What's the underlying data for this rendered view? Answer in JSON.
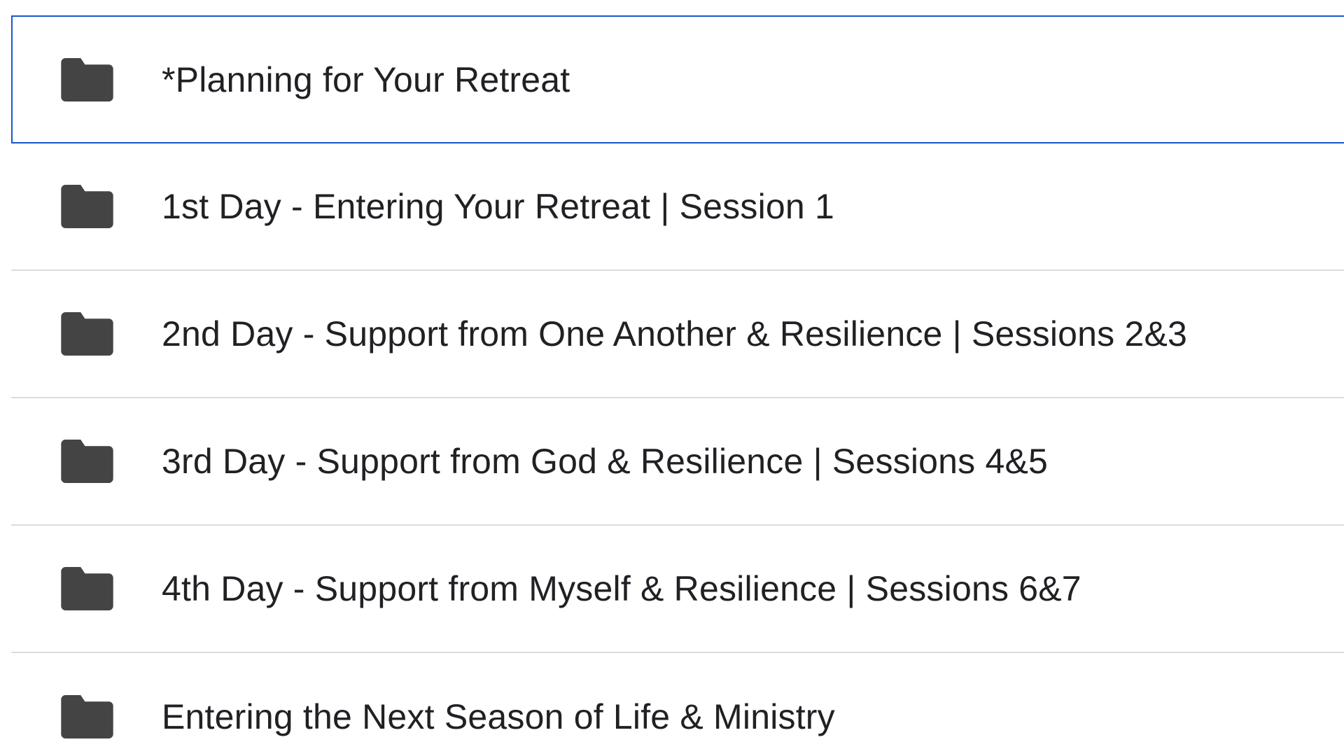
{
  "colors": {
    "selection_border": "#1a56c8",
    "divider": "#dadce0",
    "folder_icon": "#444444",
    "text": "#202124"
  },
  "folders": [
    {
      "name": "*Planning for Your Retreat",
      "icon": "folder-icon",
      "selected": true
    },
    {
      "name": "1st Day - Entering Your Retreat | Session 1",
      "icon": "folder-icon",
      "selected": false
    },
    {
      "name": "2nd Day - Support from One Another & Resilience | Sessions 2&3",
      "icon": "folder-icon",
      "selected": false
    },
    {
      "name": "3rd Day - Support from God & Resilience | Sessions 4&5",
      "icon": "folder-icon",
      "selected": false
    },
    {
      "name": "4th Day - Support from Myself & Resilience | Sessions 6&7",
      "icon": "folder-icon",
      "selected": false
    },
    {
      "name": "Entering the Next Season of Life & Ministry",
      "icon": "folder-icon",
      "selected": false
    }
  ]
}
